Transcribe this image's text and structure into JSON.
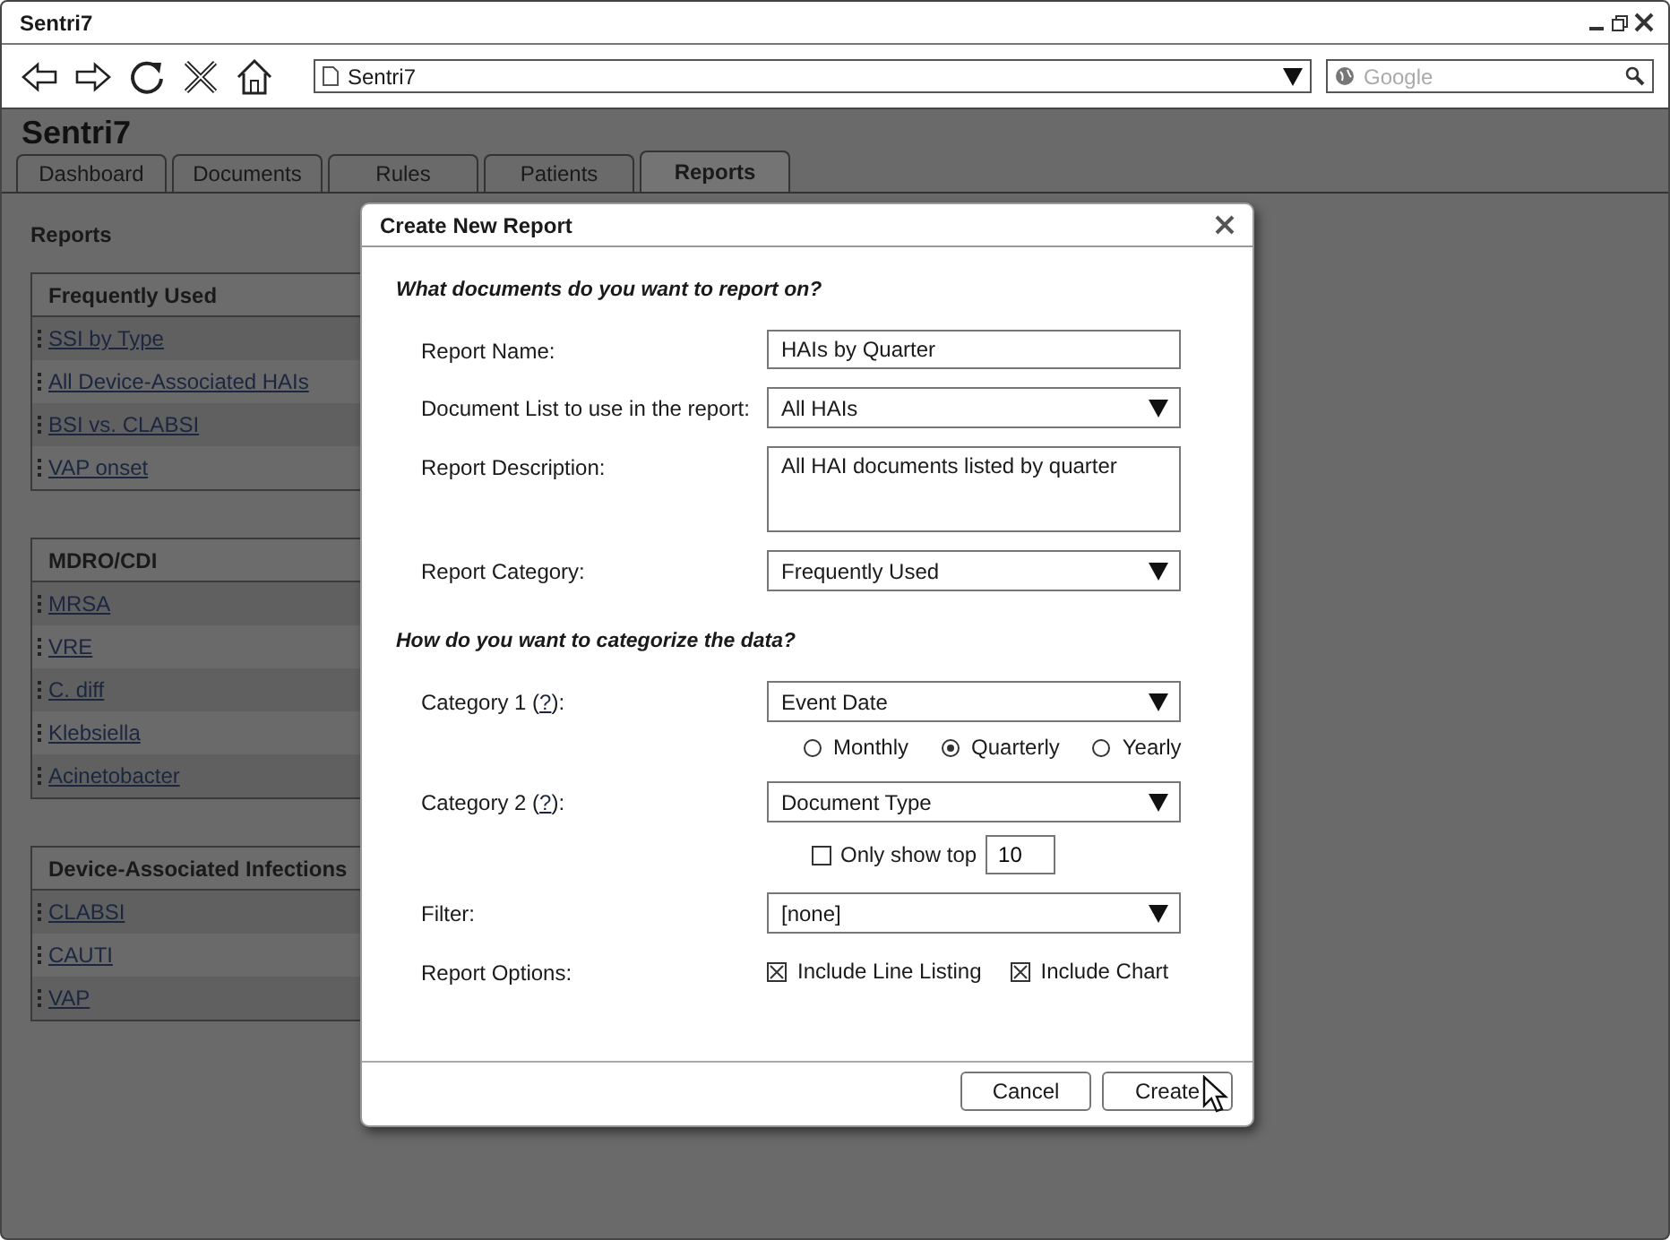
{
  "window": {
    "title": "Sentri7"
  },
  "browser": {
    "address": "Sentri7",
    "search_placeholder": "Google"
  },
  "app": {
    "title": "Sentri7",
    "tabs": [
      {
        "label": "Dashboard",
        "selected": false
      },
      {
        "label": "Documents",
        "selected": false
      },
      {
        "label": "Rules",
        "selected": false
      },
      {
        "label": "Patients",
        "selected": false
      },
      {
        "label": "Reports",
        "selected": true
      }
    ]
  },
  "sidebar": {
    "title": "Reports",
    "groups": [
      {
        "title": "Frequently Used",
        "items": [
          "SSI by Type",
          "All Device-Associated HAIs",
          "BSI vs. CLABSI",
          "VAP onset"
        ]
      },
      {
        "title": "MDRO/CDI",
        "items": [
          "MRSA",
          "VRE",
          "C. diff",
          "Klebsiella",
          "Acinetobacter"
        ]
      },
      {
        "title": "Device-Associated Infections",
        "items": [
          "CLABSI",
          "CAUTI",
          "VAP"
        ]
      }
    ]
  },
  "dialog": {
    "title": "Create New Report",
    "sections": [
      {
        "heading": "What documents do you want to report on?",
        "rows": [
          {
            "kind": "text",
            "label": "Report Name:",
            "value": "HAIs by Quarter"
          },
          {
            "kind": "select",
            "label": "Document List to use in the report:",
            "value": "All HAIs"
          },
          {
            "kind": "textarea",
            "label": "Report Description:",
            "value": "All HAI documents listed by quarter"
          },
          {
            "kind": "select",
            "label": "Report Category:",
            "value": "Frequently Used"
          }
        ]
      },
      {
        "heading": "How do you want to categorize the data?",
        "rows": [
          {
            "kind": "select",
            "label": "Category 1 (",
            "help": "?",
            "label_end": "):",
            "value": "Event Date",
            "radios": [
              {
                "label": "Monthly",
                "selected": false
              },
              {
                "label": "Quarterly",
                "selected": true
              },
              {
                "label": "Yearly",
                "selected": false
              }
            ]
          },
          {
            "kind": "select",
            "label": "Category 2 (",
            "help": "?",
            "label_end": "):",
            "value": "Document Type",
            "top": {
              "label": "Only show top",
              "checked": false,
              "value": "10"
            }
          },
          {
            "kind": "select",
            "label": "Filter:",
            "value": "[none]"
          },
          {
            "kind": "checks",
            "label": "Report Options:",
            "options": [
              {
                "label": "Include Line Listing",
                "checked": true
              },
              {
                "label": "Include Chart",
                "checked": true
              }
            ]
          }
        ]
      }
    ],
    "buttons": [
      "Cancel",
      "Create"
    ]
  }
}
